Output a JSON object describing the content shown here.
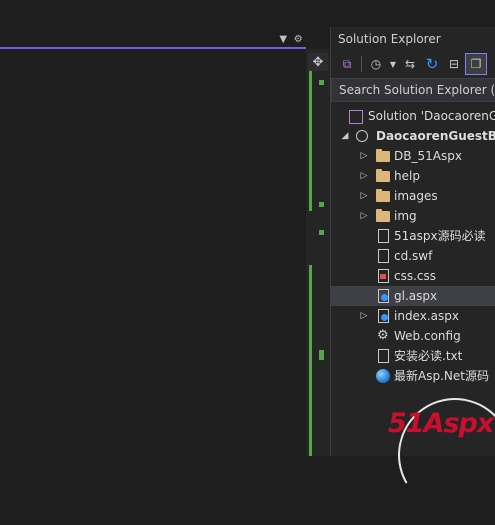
{
  "panel": {
    "title": "Solution Explorer",
    "search_placeholder": "Search Solution Explorer (C"
  },
  "toolbar_icons": [
    "vs-switch-icon",
    "history-clock-icon",
    "dropdown-arrow-icon",
    "sync-with-active-icon",
    "refresh-icon",
    "collapse-all-icon",
    "show-all-files-icon"
  ],
  "tree": [
    {
      "label": "Solution 'DaocaorenG",
      "icon": "solution-icon",
      "indent": 0
    },
    {
      "label": "DaocaorenGuestB",
      "icon": "website-globe-icon",
      "indent": 1,
      "expanded": true
    },
    {
      "label": "DB_51Aspx",
      "icon": "folder-icon",
      "indent": 2,
      "expandable": true
    },
    {
      "label": "help",
      "icon": "folder-icon",
      "indent": 2,
      "expandable": true
    },
    {
      "label": "images",
      "icon": "folder-icon",
      "indent": 2,
      "expandable": true
    },
    {
      "label": "img",
      "icon": "folder-icon",
      "indent": 2,
      "expandable": true
    },
    {
      "label": "51aspx源码必读",
      "icon": "file-icon",
      "indent": 2
    },
    {
      "label": "cd.swf",
      "icon": "file-icon",
      "indent": 2
    },
    {
      "label": "css.css",
      "icon": "css-file-icon",
      "indent": 2
    },
    {
      "label": "gl.aspx",
      "icon": "aspx-file-icon",
      "indent": 2,
      "selected": true
    },
    {
      "label": "index.aspx",
      "icon": "aspx-file-icon",
      "indent": 2,
      "expandable": true
    },
    {
      "label": "Web.config",
      "icon": "config-gear-icon",
      "indent": 2
    },
    {
      "label": "安装必读.txt",
      "icon": "file-icon",
      "indent": 2
    },
    {
      "label": "最新Asp.Net源码",
      "icon": "web-link-icon",
      "indent": 2
    }
  ],
  "logo_text": "51Aspx",
  "colors": {
    "accent": "#7160e8",
    "change_marker": "#57a64a",
    "folder": "#dcb67a",
    "selection": "#3f3f46"
  }
}
